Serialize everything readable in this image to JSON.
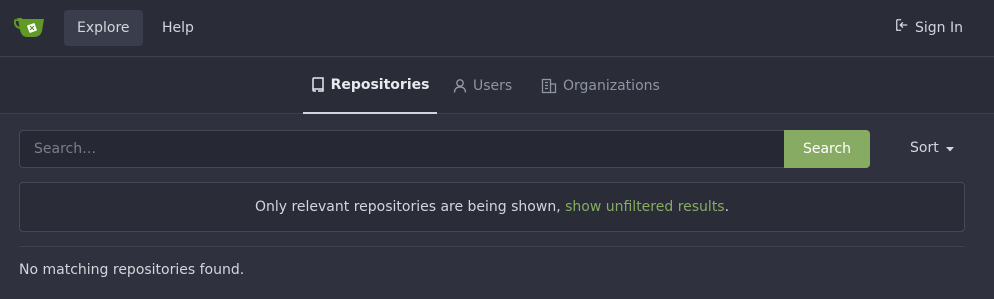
{
  "navbar": {
    "logo_icon": "gitea-teacup-logo",
    "items": [
      {
        "label": "Explore",
        "active": true
      },
      {
        "label": "Help",
        "active": false
      }
    ],
    "signin_label": "Sign In",
    "signin_icon": "sign-in-icon"
  },
  "tabs": [
    {
      "label": "Repositories",
      "icon": "repo-icon",
      "active": true
    },
    {
      "label": "Users",
      "icon": "person-icon",
      "active": false
    },
    {
      "label": "Organizations",
      "icon": "organization-icon",
      "active": false
    }
  ],
  "search": {
    "placeholder": "Search…",
    "value": "",
    "button_label": "Search"
  },
  "sort": {
    "label": "Sort",
    "icon": "caret-down-icon"
  },
  "notice": {
    "text": "Only relevant repositories are being shown, ",
    "link_text": "show unfiltered results",
    "suffix": "."
  },
  "empty_message": "No matching repositories found.",
  "colors": {
    "accent": "#87ab63",
    "background": "#2f323e",
    "header": "#2a2c38"
  }
}
